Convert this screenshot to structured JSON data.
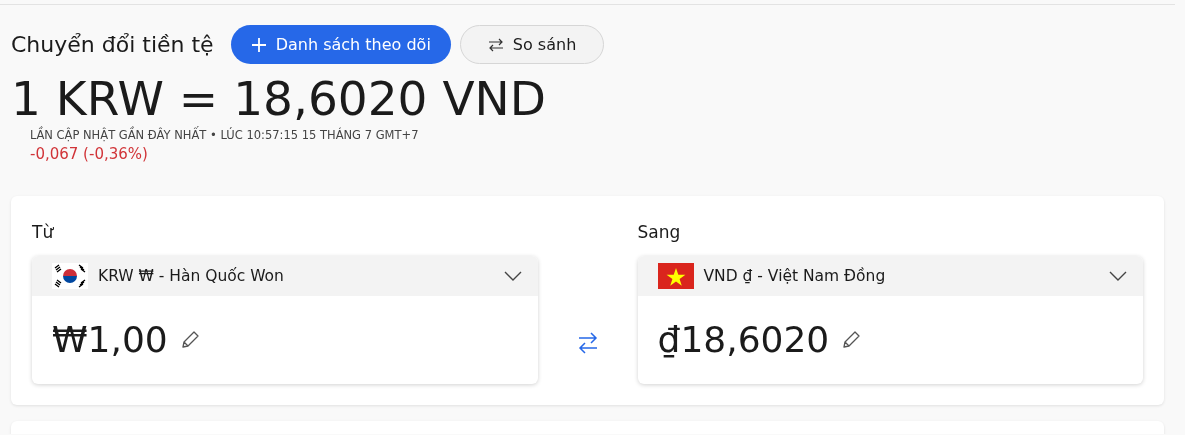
{
  "title": "Chuyển đổi tiền tệ",
  "buttons": [
    {
      "kind": "add",
      "label": "Danh sách theo dõi",
      "primary": true
    },
    {
      "kind": "compare",
      "label": "So sánh",
      "primary": false
    }
  ],
  "rate": "1 KRW = 18,6020 VND",
  "updated": "LẦN CẬP NHẬT GẦN ĐÂY NHẤT • LÚC 10:57:15 15 THÁNG 7 GMT+7",
  "change": "-0,067 (-0,36%)",
  "converter": [
    {
      "label": "Từ",
      "kind": "kr",
      "currency": "KRW ₩ - Hàn Quốc Won",
      "amount": "₩1,00"
    },
    {
      "label": "Sang",
      "kind": "vn",
      "currency": "VND ₫ - Việt Nam Đồng",
      "amount": "₫18,6020"
    }
  ]
}
